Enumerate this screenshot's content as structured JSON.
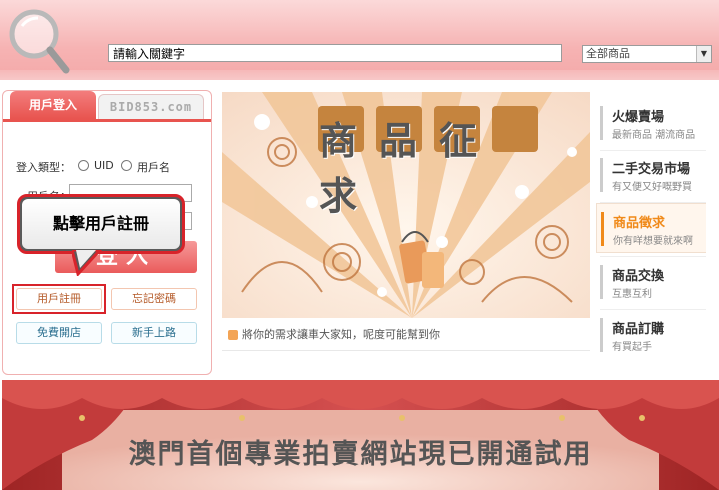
{
  "header": {
    "search_value": "請輸入關鍵字",
    "category_selected": "全部商品"
  },
  "login": {
    "tab_login": "用戶登入",
    "tab_bid": "BID853.com",
    "login_type_label": "登入類型：",
    "option_uid": "UID",
    "option_username": "用戶名",
    "field_username_label": "用戶名：",
    "login_button": "登入",
    "register_button": "用戶註冊",
    "forgot_password_button": "忘記密碼",
    "open_shop_button": "免費開店",
    "newbie_button": "新手上路"
  },
  "callout": {
    "text": "點擊用戶註冊"
  },
  "banner": {
    "title": "商品征求",
    "caption": "將你的需求讓車大家知，呢度可能幫到你"
  },
  "menu": {
    "items": [
      {
        "title": "火爆賣場",
        "subtitle": "最新商品 潮流商品"
      },
      {
        "title": "二手交易市場",
        "subtitle": "有又便又好嘅野買"
      },
      {
        "title": "商品徵求",
        "subtitle": "你有咩想要就來啊"
      },
      {
        "title": "商品交換",
        "subtitle": "互惠互利"
      },
      {
        "title": "商品訂購",
        "subtitle": "有買起手"
      }
    ]
  },
  "bottom_banner": {
    "text": "澳門首個專業拍賣網站現已開通試用"
  },
  "colors": {
    "header_pink": "#f6b3b3",
    "tab_red": "#e8544f",
    "highlight_red": "#d8232a",
    "menu_active_orange": "#f08a1a"
  }
}
